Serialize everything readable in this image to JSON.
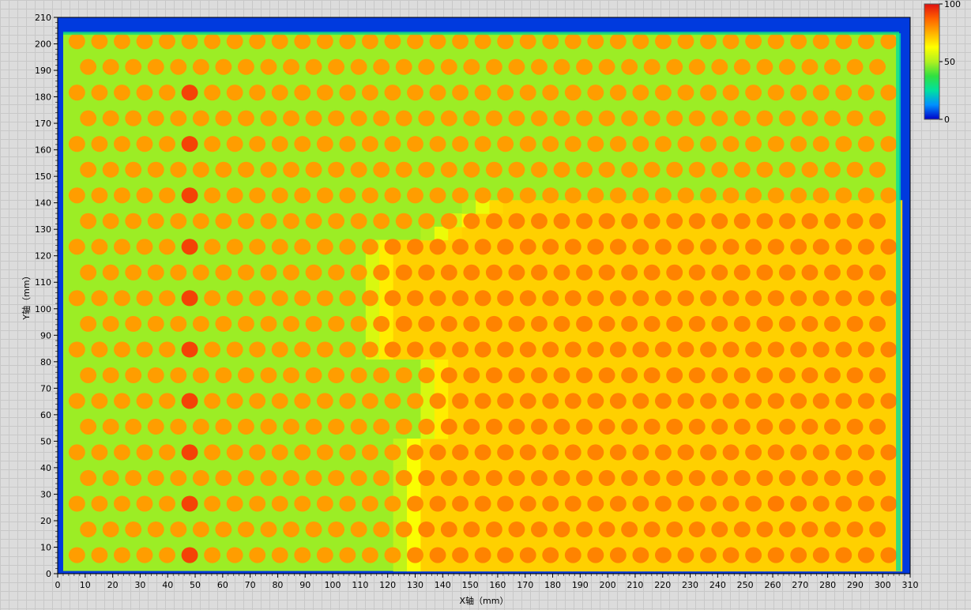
{
  "chart_data": {
    "type": "heatmap",
    "xlabel": "X轴（mm）",
    "ylabel": "Y轴（mm）",
    "xlim": [
      0,
      310
    ],
    "ylim": [
      0,
      210
    ],
    "xticks": [
      0,
      10,
      20,
      30,
      40,
      50,
      60,
      70,
      80,
      90,
      100,
      110,
      120,
      130,
      140,
      150,
      160,
      170,
      180,
      190,
      200,
      210,
      220,
      230,
      240,
      250,
      260,
      270,
      280,
      290,
      300,
      310
    ],
    "yticks": [
      0,
      10,
      20,
      30,
      40,
      50,
      60,
      70,
      80,
      90,
      100,
      110,
      120,
      130,
      140,
      150,
      160,
      170,
      180,
      190,
      200,
      210
    ],
    "colorbar": {
      "min": 0,
      "max": 100,
      "ticks": [
        0,
        50,
        100
      ]
    },
    "colormap": [
      "#0000c8",
      "#0090ff",
      "#00e0a0",
      "#30e040",
      "#b0f020",
      "#ffff00",
      "#ffb000",
      "#ff6000",
      "#e01010"
    ],
    "grid": false,
    "pattern": {
      "description_values": "periodic hexagonal dot array; dot pitch ~8.2 mm in x, ~10 mm row spacing in y",
      "dot_pitch_x": 8.2,
      "row_pitch_y": 9.7,
      "sample_extent_x": [
        2,
        306
      ],
      "sample_extent_y": [
        1,
        204
      ],
      "background_value_upper_left": 48,
      "dot_value_upper_left": 78,
      "background_value_lower_right": 70,
      "dot_value_lower_right": 82,
      "hot_column_x": 48.5,
      "hot_column_value": 92,
      "hot_corner_center": [
        265,
        25
      ],
      "hot_corner_value": 84,
      "frame_value": 5
    }
  }
}
